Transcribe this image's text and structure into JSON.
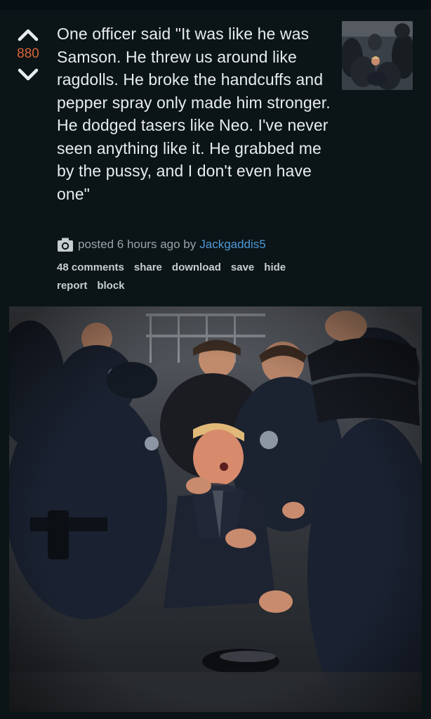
{
  "post": {
    "score": "880",
    "title": "One officer said \"It was like he was Samson. He threw us around like ragdolls. He broke the handcuffs and pepper spray only made him stronger. He dodged tasers like Neo. I've never seen anything like it. He grabbed me by the pussy, and I don't even have one\"",
    "posted_text": "posted 6 hours ago by",
    "author": "Jackgaddis5"
  },
  "actions": {
    "comments": "48 comments",
    "share": "share",
    "download": "download",
    "save": "save",
    "hide": "hide",
    "report": "report",
    "block": "block"
  },
  "colors": {
    "background": "#0b1416",
    "score": "#d9653b",
    "author_link": "#4f9ad8",
    "title_text": "#e8ecee"
  },
  "icons": {
    "upvote": "chevron-up-icon",
    "downvote": "chevron-down-icon",
    "meta": "camera-icon"
  }
}
